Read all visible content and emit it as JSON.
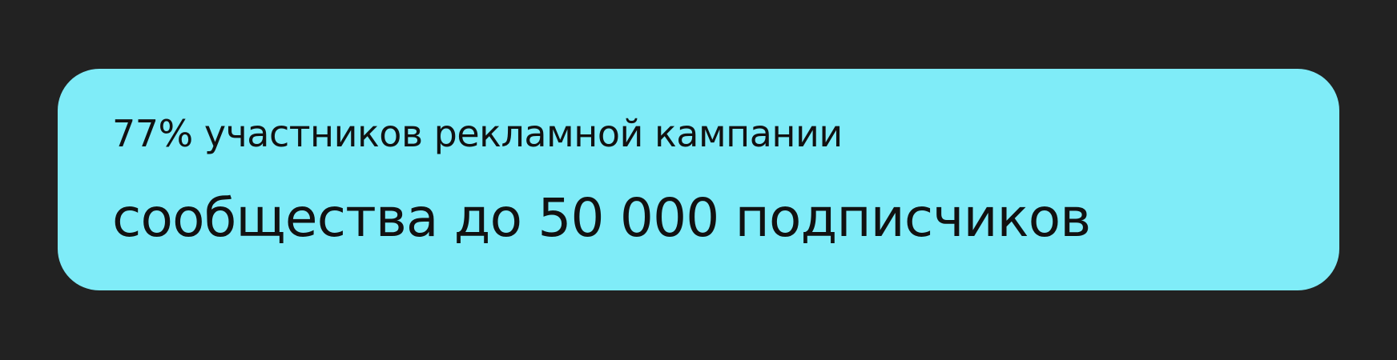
{
  "colors": {
    "background": "#222222",
    "card_background": "#7FECF8",
    "text": "#111111"
  },
  "card": {
    "line1": "77% участников рекламной кампании",
    "line2": "сообщества до 50 000 подписчиков"
  }
}
